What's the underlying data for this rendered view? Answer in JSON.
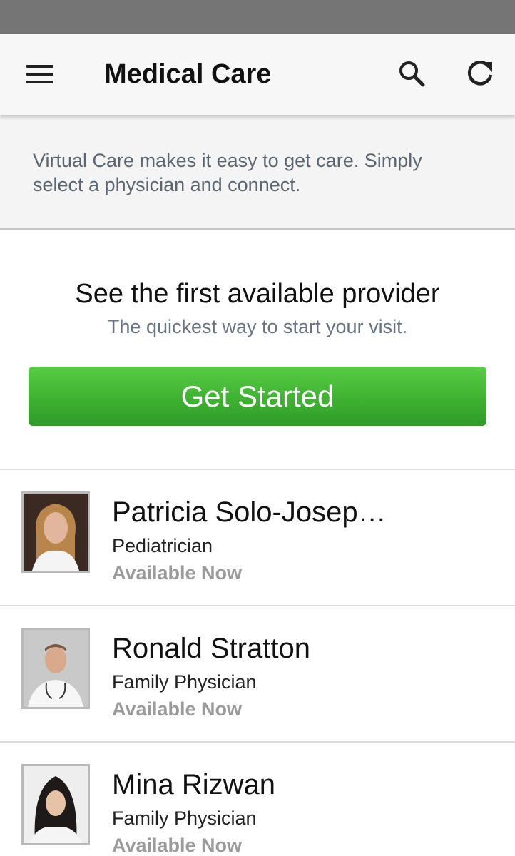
{
  "app_bar": {
    "title": "Medical Care",
    "menu_icon": "hamburger-menu-icon",
    "search_icon": "search-icon",
    "refresh_icon": "refresh-icon"
  },
  "intro": {
    "text": "Virtual Care makes it easy to get care. Simply select a physician and connect."
  },
  "first_available": {
    "title": "See the first available provider",
    "subtitle": "The quickest way to start your visit.",
    "button_label": "Get Started",
    "button_color": "#3fb232"
  },
  "providers": [
    {
      "name": "Patricia Solo-Josep…",
      "specialty": "Pediatrician",
      "status": "Available Now"
    },
    {
      "name": "Ronald Stratton",
      "specialty": "Family Physician",
      "status": "Available Now"
    },
    {
      "name": "Mina Rizwan",
      "specialty": "Family Physician",
      "status": "Available Now"
    }
  ],
  "colors": {
    "status_bar": "#757575",
    "app_bar_bg": "#f7f7f7",
    "available_text": "#9b9b9b"
  }
}
